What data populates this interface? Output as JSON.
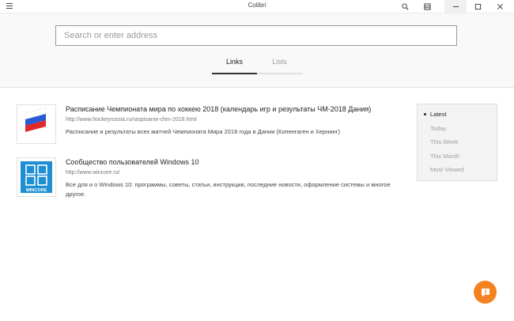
{
  "window": {
    "title": "Colibri"
  },
  "address": {
    "placeholder": "Search or enter address",
    "value": ""
  },
  "tabs": [
    {
      "label": "Links",
      "active": true
    },
    {
      "label": "Lists",
      "active": false
    }
  ],
  "results": [
    {
      "title": "Расписание Чемпионата мира по хоккею 2018 (календарь игр и результаты ЧМ-2018 Дания)",
      "url": "http://www.hockeyrussia.ru/raspisanie-chm-2018.html",
      "description": "Расписание и результаты всех матчей Чемпионата Мира 2018 года в Дании (Копенгаген и Хернинг)",
      "thumb_icon": "russian-flag-icon"
    },
    {
      "title": "Сообщество пользователей Windows 10",
      "url": "http://www.wincore.ru/",
      "description": "Все для и о Windows 10: программы, советы, статьи, инструкции, последние новости, оформление системы и многое другое.",
      "thumb_icon": "wincore-logo-icon",
      "thumb_label": "WINCORE"
    }
  ],
  "sidebar": {
    "items": [
      {
        "label": "Latest",
        "active": true
      },
      {
        "label": "Today",
        "active": false
      },
      {
        "label": "This Week",
        "active": false
      },
      {
        "label": "This Month",
        "active": false
      },
      {
        "label": "Most Viewed",
        "active": false
      }
    ]
  },
  "colors": {
    "accent": "#f58220",
    "wincore_blue": "#1e8fd3"
  },
  "icons": {
    "menu": "hamburger-icon",
    "search": "search-icon",
    "layout": "layout-icon",
    "minimize": "minimize-icon",
    "maximize": "maximize-icon",
    "close": "close-icon",
    "feedback": "feedback-icon"
  }
}
